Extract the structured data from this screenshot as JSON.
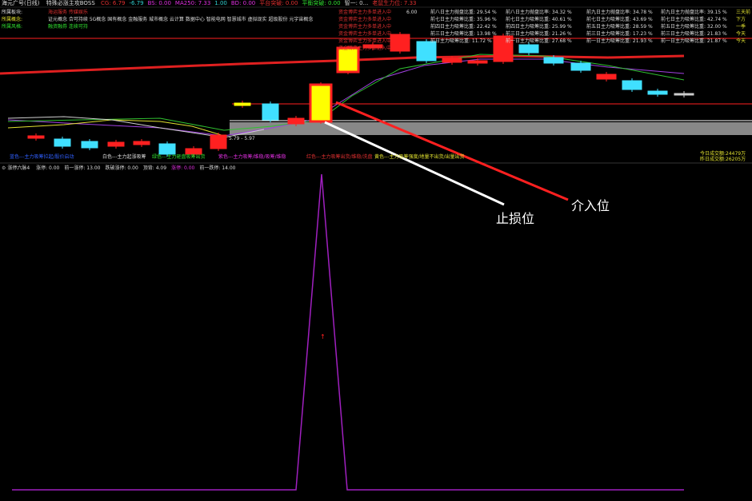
{
  "top_header": {
    "app": "海元广号(日线)",
    "indicator": "特殊必涨主攻BOSS",
    "items": [
      {
        "text": "CG: 6.79",
        "color": "#e03030"
      },
      {
        "text": "-6.79",
        "color": "#30d0d0"
      },
      {
        "text": "BS: 0.00",
        "color": "#e030e0"
      },
      {
        "text": "MA250: 7.33",
        "color": "#e030e0"
      },
      {
        "text": "1.00",
        "color": "#30d0d0"
      },
      {
        "text": "BD: 0.00",
        "color": "#e030e0"
      },
      {
        "text": "平台突破: 0.00",
        "color": "#e03030"
      },
      {
        "text": "平衡突破: 0.00",
        "color": "#30e030"
      },
      {
        "text": "智一: 0...",
        "color": "#cccccc"
      },
      {
        "text": "老鼠生力位: 7.33",
        "color": "#e03030"
      }
    ]
  },
  "left_info": [
    {
      "text": "所属板块:",
      "color": "#dddddd"
    },
    {
      "text": "所属概念:",
      "color": "#e0e030"
    },
    {
      "text": "所属风格:",
      "color": "#30e030"
    }
  ],
  "left_info2": [
    {
      "text": "海运服务   传媒娱乐",
      "color": "#e03030"
    },
    {
      "text": "证元概念  合可持续  5G概念  国有概念  金融服务  城市概念  云计算  数据中心  智能电网  智慧城市  虚拟现实  超级股份  元宇宙概念",
      "color": "#dddddd"
    },
    {
      "text": "融资融券  连续可持",
      "color": "#30e030"
    }
  ],
  "legend_list": [
    "资金博弈主力多单进入中",
    "资金博弈主力多单进入中",
    "资金博弈主力多单进入中",
    "资金博弈主力多单进入中",
    "资金博弈主力多单进入中",
    "资金博弈主力多单进入中"
  ],
  "legend_value": "6.00",
  "stats_cols": [
    [
      "前八日主力抛盘比重: 29.54 %",
      "前七日主力吸筹比重: 35.96 %",
      "前四日主力吸筹比重: 22.42 %",
      "前三日主力吸筹比重: 13.98 %",
      "前日主力吸筹比重: 11.72 %"
    ],
    [
      "前八日主力抛盘比率: 34.32 %",
      "前七日主力吸筹比重: 40.61 %",
      "前四日主力吸筹比重: 25.99 %",
      "前三日主力吸筹比重: 21.26 %",
      "前一日主力吸筹比重: 27.68 %"
    ],
    [
      "前九日主力抛盘比率: 34.78 %",
      "前七日主力吸筹比重: 43.69 %",
      "前五日主力吸筹比重: 28.59 %",
      "前三日主力吸筹比重: 17.23 %",
      "前一日主力吸筹比重: 21.93 %"
    ],
    [
      "前九日主力抛盘比率: 39.15 %",
      "前七日主力吸筹比重: 42.74 %",
      "前五日主力吸筹比重: 32.00 %",
      "前三日主力吸筹比重: 21.83 %",
      "前一日主力吸筹比重: 21.87 %"
    ]
  ],
  "right_edge": [
    "三天前",
    "下方",
    "一季",
    "今天",
    "今天"
  ],
  "price_marks": {
    "left_low": "5.79 - 5.97"
  },
  "bottom_labels": [
    {
      "text": "蓝色---主力吸筹拉起/股价启动",
      "color": "#3060ff"
    },
    {
      "text": "白色---主力起涨吸筹",
      "color": "#dddddd"
    },
    {
      "text": "绿色---主力砸盘吸筹出货",
      "color": "#30e030"
    },
    {
      "text": "紫色---主力吸筹/维稳/吸筹/维稳",
      "color": "#e030e0"
    },
    {
      "text": "红色---主力吸筹出货/维稳/洗盘",
      "color": "#e03030"
    },
    {
      "text": "黄色---主力吸筹强度/地量不出货/出量出货",
      "color": "#e0e030"
    }
  ],
  "today_turnover": "今日成交额:24479万",
  "yesterday_turnover": "昨日成交额:26205万",
  "lower_header": {
    "name": "涨停六脉4",
    "items": [
      {
        "text": "涨停: 0.00",
        "color": "#dddddd"
      },
      {
        "text": "前一涨停: 13.00",
        "color": "#dddddd"
      },
      {
        "text": "跌破涨停: 0.00",
        "color": "#dddddd"
      },
      {
        "text": "顶背: 4.09",
        "color": "#dddddd"
      },
      {
        "text": "涨停: 0.00",
        "color": "#e030e0"
      },
      {
        "text": "前一跌停: 14.00",
        "color": "#dddddd"
      }
    ]
  },
  "annotations": {
    "stop_loss": "止损位",
    "entry": "介入位"
  },
  "colors": {
    "up": "#ff2020",
    "down": "#40e0ff",
    "yellow": "#ffff00",
    "purple": "#a020c0"
  }
}
